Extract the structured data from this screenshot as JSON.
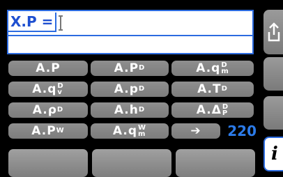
{
  "input": {
    "label": "X.P =",
    "value": ""
  },
  "buttons": [
    {
      "id": "a-p",
      "base": "A.P",
      "sup": "",
      "sub": ""
    },
    {
      "id": "a-p-d",
      "base": "A.P",
      "sup": "D",
      "sub": ""
    },
    {
      "id": "a-q-d-m",
      "base": "A.q",
      "sup": "D",
      "sub": "m"
    },
    {
      "id": "a-q-d-v",
      "base": "A.q",
      "sup": "D",
      "sub": "v"
    },
    {
      "id": "a-rho-d",
      "base": "A.p",
      "sup": "D",
      "sub": ""
    },
    {
      "id": "a-t-d",
      "base": "A.T",
      "sup": "D",
      "sub": ""
    },
    {
      "id": "a-rho-d-2",
      "base": "A.ρ",
      "sup": "D",
      "sub": ""
    },
    {
      "id": "a-h-d",
      "base": "A.h",
      "sup": "D",
      "sub": ""
    },
    {
      "id": "a-delta-p-d",
      "base": "A.Δ",
      "sup": "D",
      "sub": "P"
    },
    {
      "id": "a-p-w",
      "base": "A.P",
      "sup": "W",
      "sub": ""
    },
    {
      "id": "a-q-w-m",
      "base": "A.q",
      "sup": "W",
      "sub": "m"
    },
    {
      "id": "next",
      "base": "➔",
      "sup": "",
      "sub": ""
    }
  ],
  "count": "220",
  "side": {
    "export_icon": "export-icon",
    "info_icon": "info-icon",
    "info_label": "i"
  },
  "colors": {
    "accent": "#2c6be0",
    "count": "#2c7be8",
    "pill": "#8a8a8a"
  }
}
